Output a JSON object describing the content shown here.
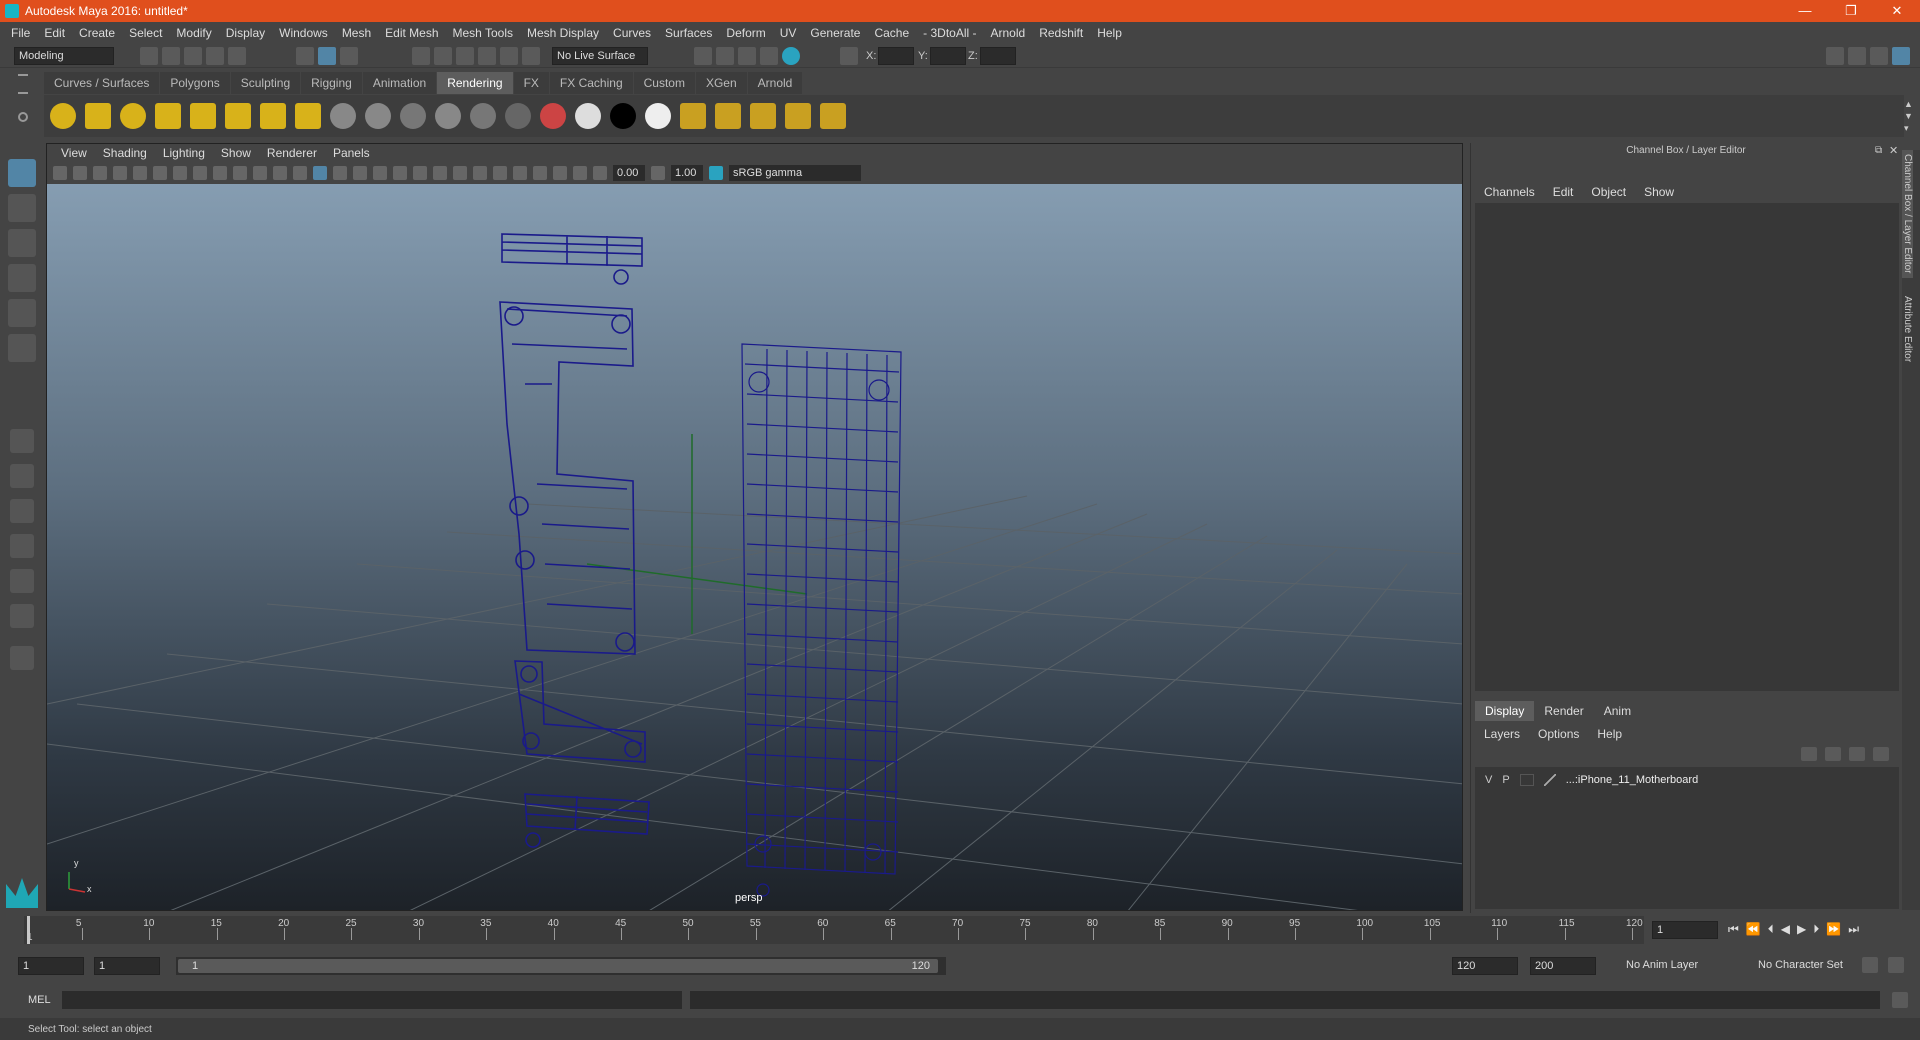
{
  "window": {
    "title": "Autodesk Maya 2016: untitled*",
    "min": "—",
    "max": "❐",
    "close": "✕"
  },
  "menus": [
    "File",
    "Edit",
    "Create",
    "Select",
    "Modify",
    "Display",
    "Windows",
    "Mesh",
    "Edit Mesh",
    "Mesh Tools",
    "Mesh Display",
    "Curves",
    "Surfaces",
    "Deform",
    "UV",
    "Generate",
    "Cache",
    "- 3DtoAll -",
    "Arnold",
    "Redshift",
    "Help"
  ],
  "statusline": {
    "mode": "Modeling",
    "live_surface": "No Live Surface",
    "x_label": "X:",
    "y_label": "Y:",
    "z_label": "Z:"
  },
  "shelf_tabs": [
    "Curves / Surfaces",
    "Polygons",
    "Sculpting",
    "Rigging",
    "Animation",
    "Rendering",
    "FX",
    "FX Caching",
    "Custom",
    "XGen",
    "Arnold"
  ],
  "shelf_active": "Rendering",
  "viewport": {
    "menus": [
      "View",
      "Shading",
      "Lighting",
      "Show",
      "Renderer",
      "Panels"
    ],
    "near": "0.00",
    "far": "1.00",
    "color_space": "sRGB gamma",
    "camera": "persp",
    "axis_y": "y",
    "axis_x": "x"
  },
  "channel_box": {
    "title": "Channel Box / Layer Editor",
    "menus": [
      "Channels",
      "Edit",
      "Object",
      "Show"
    ]
  },
  "layer_editor": {
    "tabs": [
      "Display",
      "Render",
      "Anim"
    ],
    "active_tab": "Display",
    "menus": [
      "Layers",
      "Options",
      "Help"
    ],
    "layers": [
      {
        "v": "V",
        "p": "P",
        "name": "...:iPhone_11_Motherboard"
      }
    ]
  },
  "side_tabs": [
    "Channel Box / Layer Editor",
    "Attribute Editor"
  ],
  "timeline": {
    "labels": [
      "5",
      "10",
      "15",
      "20",
      "25",
      "30",
      "35",
      "40",
      "45",
      "50",
      "55",
      "60",
      "65",
      "70",
      "75",
      "80",
      "85",
      "90",
      "95",
      "100",
      "105",
      "110",
      "115",
      "120"
    ],
    "start_label": "1",
    "current_frame": "1"
  },
  "range": {
    "start": "1",
    "start2": "1",
    "range_start": "1",
    "range_end": "120",
    "end": "120",
    "end2": "200",
    "anim_layer": "No Anim Layer",
    "char_set": "No Character Set"
  },
  "cmd": {
    "label": "MEL"
  },
  "help_line": "Select Tool: select an object",
  "colors": {
    "title": "#e04f1d",
    "wire": "#1a1a8a",
    "accent": "#5285a6"
  }
}
